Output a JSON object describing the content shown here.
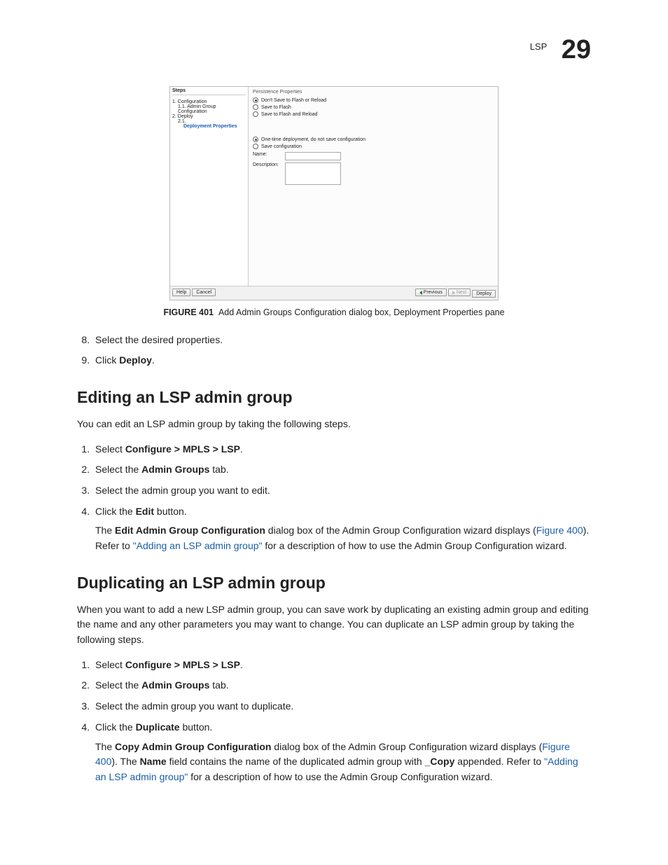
{
  "header": {
    "section": "LSP",
    "chapter": "29"
  },
  "dialog": {
    "steps_title": "Steps",
    "steps": {
      "s1": "1. Configuration",
      "s1_1": "1.1. Admin Group Configuration",
      "s2": "2. Deploy",
      "s2_1_prefix": "2.1.",
      "s2_1": "Deployment Properties"
    },
    "panel_title": "Persistence Properties",
    "radios": {
      "r1": "Don't Save to Flash or Reload",
      "r2": "Save to Flash",
      "r3": "Save to Flash and Reload",
      "r4": "One-time deployment, do not save configuration",
      "r5": "Save configuration"
    },
    "form": {
      "name_label": "Name:",
      "desc_label": "Description:"
    },
    "buttons": {
      "help": "Help",
      "cancel": "Cancel",
      "previous": "Previous",
      "next": "Next",
      "deploy": "Deploy"
    }
  },
  "figure": {
    "label": "FIGURE 401",
    "caption": "Add Admin Groups Configuration dialog box, Deployment Properties pane"
  },
  "top_steps": {
    "s8": "Select the desired properties.",
    "s9_a": "Click ",
    "s9_b": "Deploy",
    "s9_c": "."
  },
  "edit": {
    "heading": "Editing an LSP admin group",
    "lead": "You can edit an LSP admin group by taking the following steps.",
    "s1_a": "Select ",
    "s1_b": "Configure > MPLS > LSP",
    "s1_c": ".",
    "s2_a": "Select the ",
    "s2_b": "Admin Groups",
    "s2_c": " tab.",
    "s3": "Select the admin group you want to edit.",
    "s4_a": "Click the ",
    "s4_b": "Edit",
    "s4_c": " button.",
    "p_a": "The ",
    "p_b": "Edit Admin Group Configuration",
    "p_c": " dialog box of the Admin Group Configuration wizard displays (",
    "p_d": "Figure 400",
    "p_e": "). Refer to ",
    "p_f": "\"Adding an LSP admin group\"",
    "p_g": " for a description of how to use the Admin Group Configuration wizard."
  },
  "dup": {
    "heading": "Duplicating an LSP admin group",
    "lead": "When you want to add a new LSP admin group, you can save work by duplicating an existing admin group and editing the name and any other parameters you may want to change. You can duplicate an LSP admin group by taking the following steps.",
    "s1_a": "Select ",
    "s1_b": "Configure > MPLS > LSP",
    "s1_c": ".",
    "s2_a": "Select the ",
    "s2_b": "Admin Groups",
    "s2_c": " tab.",
    "s3": "Select the admin group you want to duplicate.",
    "s4_a": "Click the ",
    "s4_b": "Duplicate",
    "s4_c": " button.",
    "p_a": "The ",
    "p_b": "Copy Admin Group Configuration",
    "p_c": " dialog box of the Admin Group Configuration wizard displays (",
    "p_d": "Figure 400",
    "p_e": "). The ",
    "p_f": "Name",
    "p_g": " field contains the name of the duplicated admin group with ",
    "p_h": "_Copy",
    "p_i": " appended. Refer to ",
    "p_j": "\"Adding an LSP admin group\"",
    "p_k": " for a description of how to use the Admin Group Configuration wizard."
  }
}
